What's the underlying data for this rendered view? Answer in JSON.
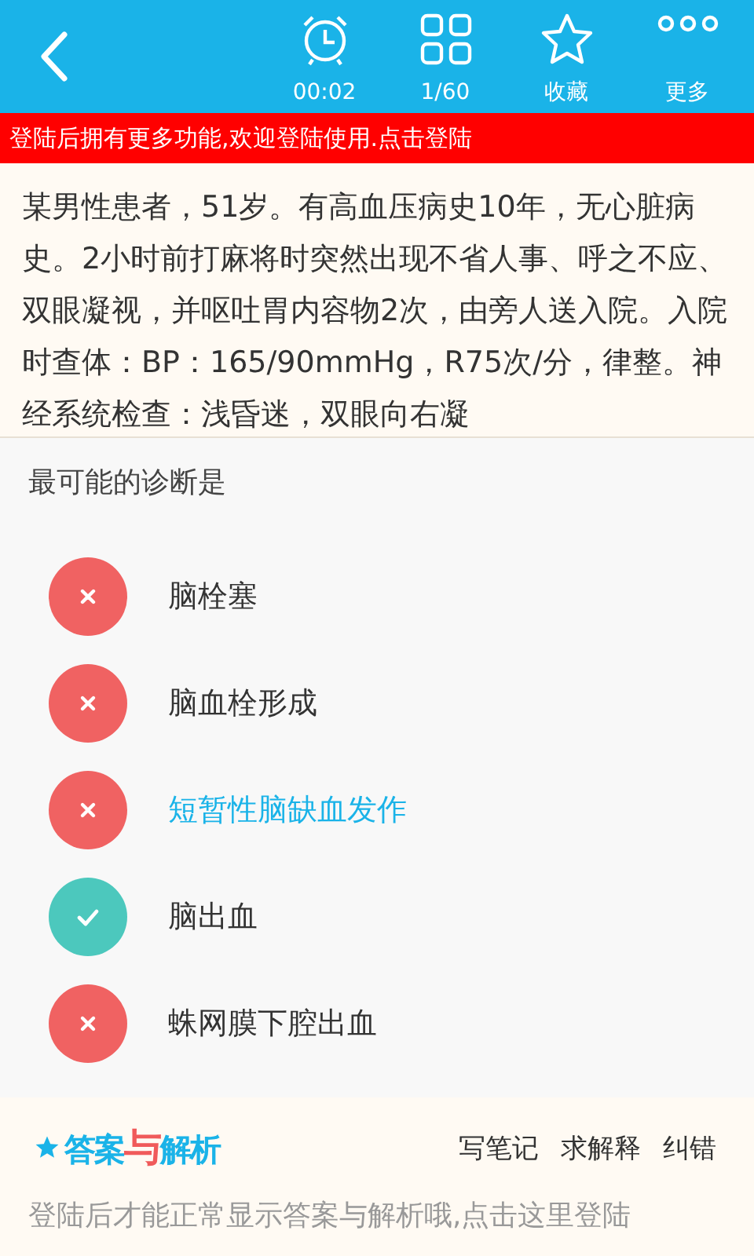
{
  "toolbar": {
    "items": [
      {
        "kind": "timer",
        "label": "00:02"
      },
      {
        "kind": "grid",
        "label": "1/60"
      },
      {
        "kind": "star",
        "label": "收藏"
      },
      {
        "kind": "more",
        "label": "更多"
      }
    ]
  },
  "login_banner": "登陆后拥有更多功能,欢迎登陆使用.点击登陆",
  "question": "某男性患者，51岁。有高血压病史10年，无心脏病史。2小时前打麻将时突然出现不省人事、呼之不应、双眼凝视，并呕吐胃内容物2次，由旁人送入院。入院时查体：BP：165/90mmHg，R75次/分，律整。神经系统检查：浅昏迷，双眼向右凝",
  "prompt": "最可能的诊断是",
  "options": [
    {
      "text": "脑栓塞",
      "kind": "wrong",
      "selected": false
    },
    {
      "text": "脑血栓形成",
      "kind": "wrong",
      "selected": false
    },
    {
      "text": "短暂性脑缺血发作",
      "kind": "wrong",
      "selected": true
    },
    {
      "text": "脑出血",
      "kind": "correct",
      "selected": false
    },
    {
      "text": "蛛网膜下腔出血",
      "kind": "wrong",
      "selected": false
    }
  ],
  "analysis": {
    "logo": [
      {
        "text": "答案",
        "color": "#1ab3e8"
      },
      {
        "text": "与",
        "color": "#f05a5a"
      },
      {
        "text": "解析",
        "color": "#1ab3e8"
      }
    ],
    "actions": [
      "写笔记",
      "求解释",
      "纠错"
    ],
    "notice": "登陆后才能正常显示答案与解析哦,点击这里登陆"
  }
}
